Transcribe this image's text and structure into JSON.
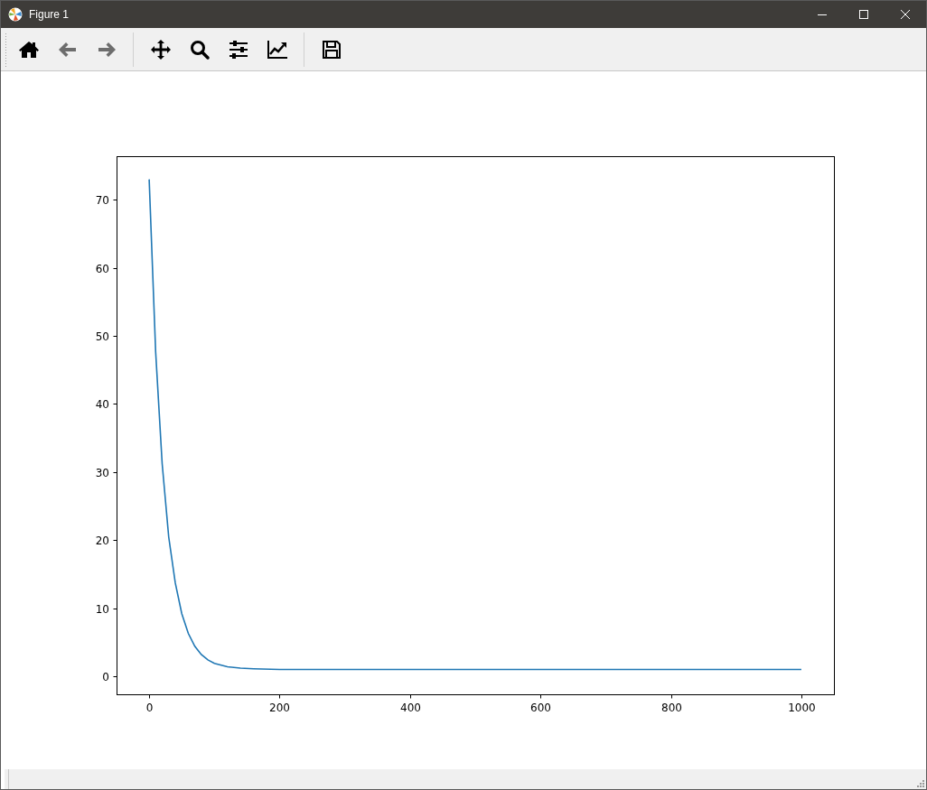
{
  "window": {
    "title": "Figure 1"
  },
  "toolbar": {
    "groups": [
      [
        {
          "kind": "home",
          "disabled": false
        },
        {
          "kind": "back",
          "disabled": true
        },
        {
          "kind": "forward",
          "disabled": true
        }
      ],
      [
        {
          "kind": "pan",
          "disabled": false
        },
        {
          "kind": "zoom",
          "disabled": false
        },
        {
          "kind": "subplots",
          "disabled": false
        },
        {
          "kind": "axes",
          "disabled": false
        }
      ],
      [
        {
          "kind": "save",
          "disabled": false
        }
      ]
    ]
  },
  "figure": {
    "chart_data": {
      "type": "line",
      "x": [
        0,
        10,
        20,
        30,
        40,
        50,
        60,
        70,
        80,
        90,
        100,
        120,
        140,
        160,
        200,
        300,
        400,
        500,
        600,
        700,
        800,
        900,
        1000
      ],
      "series": [
        {
          "color": "#1f77b4",
          "values": [
            73,
            47.6,
            31.2,
            20.5,
            13.7,
            9.2,
            6.3,
            4.4,
            3.2,
            2.4,
            1.9,
            1.4,
            1.2,
            1.1,
            1,
            1,
            1,
            1,
            1,
            1,
            1,
            1,
            1
          ]
        }
      ],
      "xlim": [
        -50,
        1050
      ],
      "ylim": [
        -2.65,
        76.4
      ],
      "xticks": [
        0,
        200,
        400,
        600,
        800,
        1000
      ],
      "yticks": [
        0,
        10,
        20,
        30,
        40,
        50,
        60,
        70
      ]
    }
  }
}
